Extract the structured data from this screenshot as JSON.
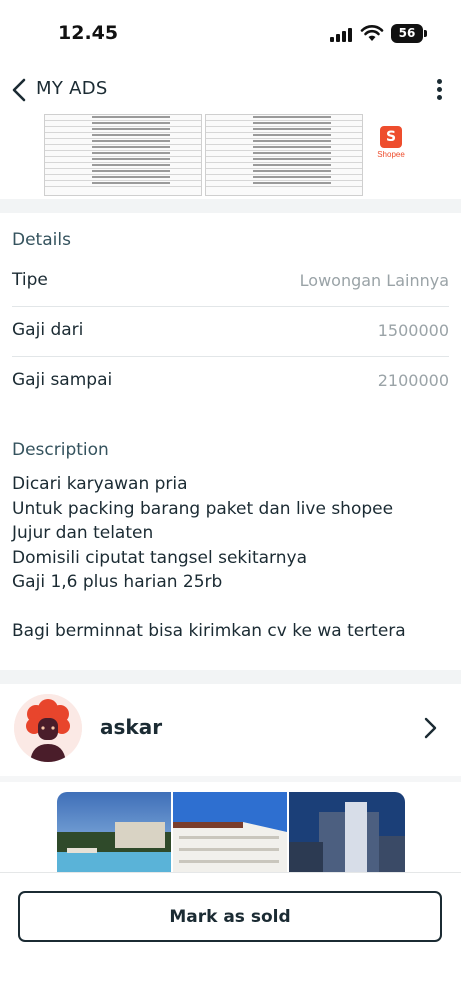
{
  "status_bar": {
    "time": "12.45",
    "battery": "56"
  },
  "header": {
    "title": "MY ADS"
  },
  "ad_image": {
    "brand_label": "Shopee"
  },
  "details": {
    "heading": "Details",
    "rows": [
      {
        "label": "Tipe",
        "value": "Lowongan Lainnya"
      },
      {
        "label": "Gaji dari",
        "value": "1500000"
      },
      {
        "label": "Gaji sampai",
        "value": "2100000"
      }
    ]
  },
  "description": {
    "heading": "Description",
    "lines": [
      "Dicari karyawan pria",
      "Untuk packing barang paket dan live shopee",
      "Jujur dan telaten",
      "Domisili ciputat tangsel sekitarnya",
      "Gaji 1,6 plus harian 25rb",
      "",
      "Bagi berminnat bisa kirimkan cv ke wa tertera"
    ]
  },
  "seller": {
    "name": "askar"
  },
  "actions": {
    "mark_sold_label": "Mark as sold"
  },
  "colors": {
    "text": "#1b2b33",
    "muted": "#9aa3a7",
    "heading": "#35535e",
    "divider": "#e2e6e8",
    "shopee": "#ee4d2d"
  }
}
